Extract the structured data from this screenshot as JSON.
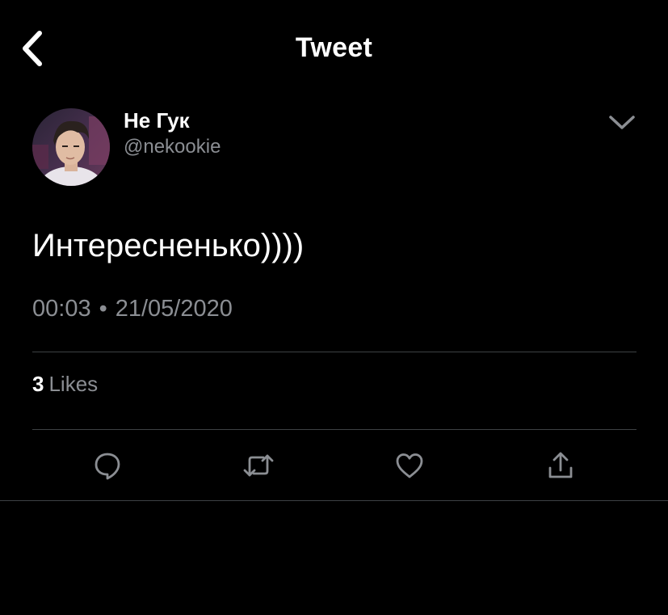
{
  "header": {
    "title": "Tweet",
    "back_icon": "chevron-left-icon"
  },
  "author": {
    "display_name": "Не Гук",
    "handle": "@nekookie",
    "more_icon": "chevron-down-icon"
  },
  "tweet": {
    "text": "Интересненько))))",
    "time": "00:03",
    "separator": "•",
    "date": "21/05/2020"
  },
  "stats": {
    "likes_count": "3",
    "likes_label": "Likes"
  },
  "actions": [
    {
      "name": "reply",
      "icon": "reply-icon"
    },
    {
      "name": "retweet",
      "icon": "retweet-icon"
    },
    {
      "name": "like",
      "icon": "heart-icon"
    },
    {
      "name": "share",
      "icon": "share-icon"
    }
  ],
  "colors": {
    "background": "#000000",
    "primary_text": "#ffffff",
    "secondary_text": "#8b8e93",
    "divider": "#3d4144",
    "icon": "#8b8e93"
  }
}
